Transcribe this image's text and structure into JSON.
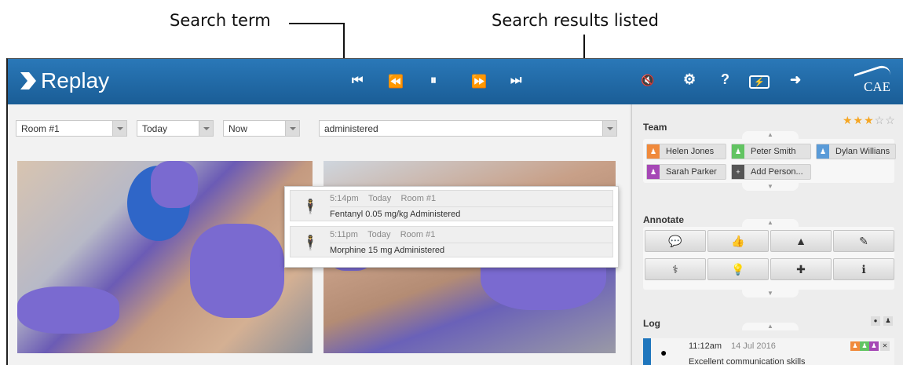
{
  "callouts": {
    "search_term": "Search term",
    "search_results": "Search results listed"
  },
  "app": {
    "title": "Replay",
    "brand": "CAE",
    "transport": {
      "first": "⏮",
      "rewind": "⏪",
      "pause": "⏸",
      "forward": "⏩",
      "last": "⏭"
    },
    "tools": {
      "mute": "🔇",
      "settings": "⚙",
      "help": "?",
      "battery": "⚡",
      "exit": "➜"
    }
  },
  "filters": {
    "room": "Room #1",
    "day": "Today",
    "time": "Now",
    "search_value": "administered"
  },
  "results": [
    {
      "time": "5:14pm",
      "day": "Today",
      "room": "Room #1",
      "desc": "Fentanyl 0.05 mg/kg Administered"
    },
    {
      "time": "5:11pm",
      "day": "Today",
      "room": "Room #1",
      "desc": "Morphine 15 mg Administered"
    }
  ],
  "rating": {
    "value": 3,
    "max": 5,
    "filled": "★★★",
    "empty": "☆☆"
  },
  "team": {
    "label": "Team",
    "members": [
      {
        "name": "Helen Jones",
        "color": "#f08a3c"
      },
      {
        "name": "Peter Smith",
        "color": "#62c462"
      },
      {
        "name": "Dylan Willians",
        "color": "#5a9bd8"
      },
      {
        "name": "Sarah Parker",
        "color": "#a648b6"
      },
      {
        "name": "Add Person...",
        "color": "#555555"
      }
    ]
  },
  "annotate": {
    "label": "Annotate",
    "icons": [
      "speech-bubble-icon",
      "thumbs-up-icon",
      "warning-icon",
      "syringe-icon",
      "stethoscope-icon",
      "lightbulb-icon",
      "medical-kit-icon",
      "info-icon"
    ],
    "glyphs": [
      "💬",
      "👍",
      "▲",
      "✎",
      "⚕",
      "💡",
      "✚",
      "ℹ"
    ]
  },
  "log": {
    "label": "Log",
    "entries": [
      {
        "time": "11:12am",
        "date": "14 Jul 2016",
        "text": "Excellent communication skills"
      }
    ]
  },
  "colors": {
    "topbar": "#1f6aa8",
    "log_accent": "#1f76bd",
    "star": "#f5a623"
  }
}
